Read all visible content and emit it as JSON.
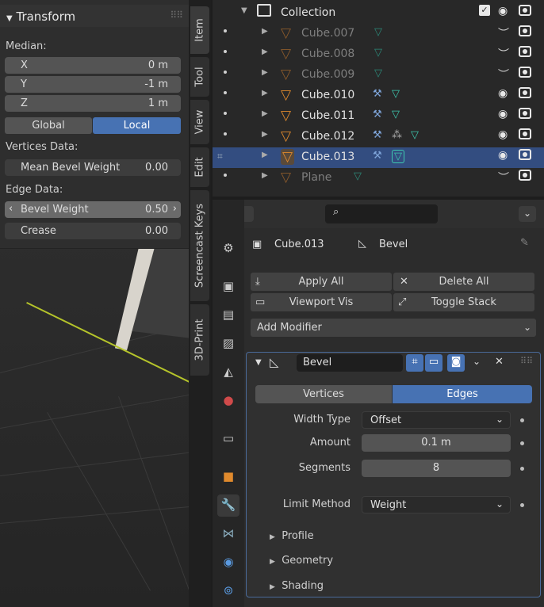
{
  "npanel": {
    "title": "Transform",
    "median": "Median:",
    "fields": [
      {
        "k": "X",
        "v": "0 m"
      },
      {
        "k": "Y",
        "v": "-1 m"
      },
      {
        "k": "Z",
        "v": "1 m"
      }
    ],
    "global": "Global",
    "local": "Local",
    "vertices_data": "Vertices Data:",
    "mean_bevel": {
      "k": "Mean Bevel Weight",
      "v": "0.00"
    },
    "edge_data": "Edge Data:",
    "bevel_weight": {
      "k": "Bevel Weight",
      "v": "0.50"
    },
    "crease": {
      "k": "Crease",
      "v": "0.00"
    }
  },
  "vtabs": [
    "Item",
    "Tool",
    "View",
    "Edit",
    "Screencast Keys",
    "3D-Print"
  ],
  "outliner": {
    "collection": "Collection",
    "rows": [
      {
        "name": "Cube.007",
        "dim": true
      },
      {
        "name": "Cube.008",
        "dim": true
      },
      {
        "name": "Cube.009",
        "dim": true
      },
      {
        "name": "Cube.010",
        "dim": false
      },
      {
        "name": "Cube.011",
        "dim": false
      },
      {
        "name": "Cube.012",
        "dim": false
      },
      {
        "name": "Cube.013",
        "dim": false,
        "selected": true
      },
      {
        "name": "Plane",
        "dim": true
      }
    ]
  },
  "props": {
    "object": "Cube.013",
    "modifier": "Bevel",
    "apply_all": "Apply All",
    "delete_all": "Delete All",
    "viewport_vis": "Viewport Vis",
    "toggle_stack": "Toggle Stack",
    "add_modifier": "Add Modifier",
    "mod_name": "Bevel",
    "vertices": "Vertices",
    "edges": "Edges",
    "width_type_lbl": "Width Type",
    "width_type": "Offset",
    "amount_lbl": "Amount",
    "amount": "0.1 m",
    "segments_lbl": "Segments",
    "segments": "8",
    "limit_lbl": "Limit Method",
    "limit": "Weight",
    "profile": "Profile",
    "geometry": "Geometry",
    "shading": "Shading"
  },
  "colors": {
    "accent": "#4772b3",
    "selected_row": "#334d80"
  }
}
